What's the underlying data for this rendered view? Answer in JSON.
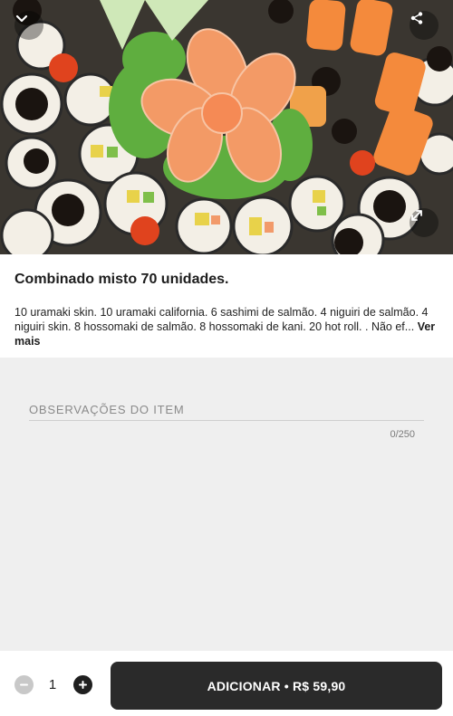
{
  "product": {
    "title": "Combinado misto 70 unidades.",
    "description": "10 uramaki skin. 10 uramaki california. 6 sashimi de salmão. 4 niguiri de salmão. 4 niguiri skin. 8 hossomaki de salmão. 8 hossomaki de kani. 20 hot roll. . Não ef...",
    "see_more_label": "Ver mais"
  },
  "observations": {
    "label": "OBSERVAÇÕES DO ITEM",
    "counter": "0/250"
  },
  "cart": {
    "quantity": "1",
    "add_button_label": "ADICIONAR • R$ 59,90"
  },
  "icons": {
    "collapse": "chevron-down-icon",
    "share": "share-icon",
    "expand": "expand-icon",
    "minus": "minus-icon",
    "plus": "plus-icon"
  },
  "colors": {
    "accent_dark": "#2a2a2a",
    "minus_disabled": "#c8c8c8",
    "background": "#efefef"
  }
}
